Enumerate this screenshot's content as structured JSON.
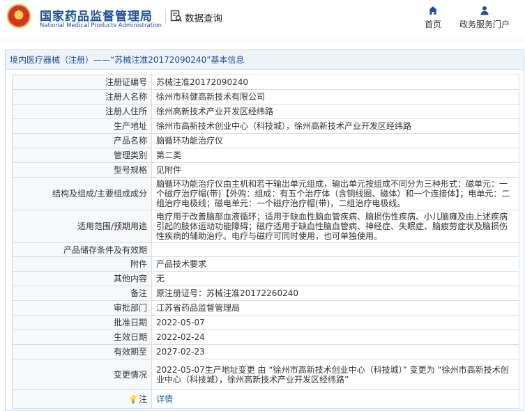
{
  "header": {
    "brand_cn": "国家药品监督管理局",
    "brand_en": "National Medical Products Administration",
    "search_title": "数据查询",
    "nav": {
      "home_label": "首页",
      "portal_label": "政务服务门户"
    }
  },
  "panel": {
    "title": "境内医疗器械（注册）——“苏械注准20172090240”基本信息"
  },
  "rows": [
    {
      "label": "注册证编号",
      "value": "苏械注准20172090240"
    },
    {
      "label": "注册人名称",
      "value": "徐州市科健高新技术有限公司"
    },
    {
      "label": "注册人住所",
      "value": "徐州高新技术产业开发区经纬路"
    },
    {
      "label": "生产地址",
      "value": "徐州市高新技术创业中心（科技城），徐州高新技术产业开发区经纬路"
    },
    {
      "label": "产品名称",
      "value": "脑循环功能治疗仪"
    },
    {
      "label": "管理类别",
      "value": "第二类"
    },
    {
      "label": "型号规格",
      "value": "见附件"
    },
    {
      "label": "结构及组成/主要组成成分",
      "value": "脑循环功能治疗仪由主机和若干输出单元组成，输出单元按组成不同分为三种形式：磁单元：一个磁疗治疗帽(带)【外购：组成：有五个治疗体（含铜线圈、磁体）和一个连接体】；电单元：二组治疗电极线；磁电单元：一个磁疗治疗帽(带)，二组治疗电极线。"
    },
    {
      "label": "适用范围/预期用途",
      "value": "电疗用于改善脑部血液循环；适用于缺血性脑血管疾病、脑损伤性疾病、小儿脑瘫及由上述疾病引起的肢体运动功能障碍；磁疗适用于缺血性脑血管病、神经症、失眠症、脑疲劳症状及脑损伤性疾病的辅助治疗。电疗与磁疗可同时使用，也可单独使用。"
    },
    {
      "label": "产品储存条件及有效期",
      "value": ""
    },
    {
      "label": "附件",
      "value": "产品技术要求"
    },
    {
      "label": "其他内容",
      "value": "无"
    },
    {
      "label": "备注",
      "value": "原注册证号：苏械注准20172260240"
    },
    {
      "label": "审批部门",
      "value": "江苏省药品监督管理局"
    },
    {
      "label": "批准日期",
      "value": "2022-05-07"
    },
    {
      "label": "生效日期",
      "value": "2022-02-24"
    },
    {
      "label": "有效期至",
      "value": "2027-02-23"
    },
    {
      "label": "变更情况",
      "value": "2022-05-07生产地址变更 由 “徐州市高新技术创业中心（科技城）” 变更为 “徐州市高新技术创业中心（科技城），徐州高新技术产业开发区经纬路”"
    },
    {
      "label": "注",
      "value": "详情"
    }
  ]
}
